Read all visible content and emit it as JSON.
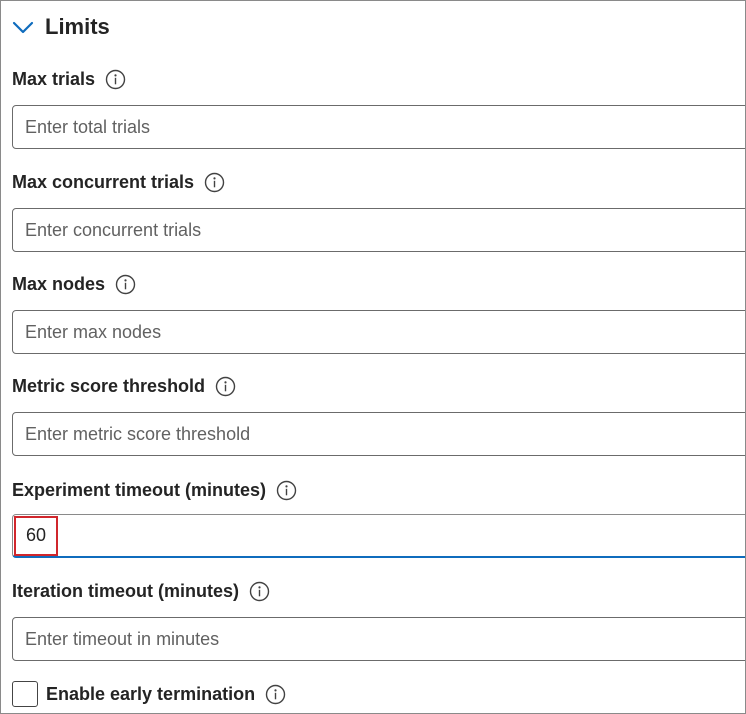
{
  "section": {
    "title": "Limits",
    "expanded": true
  },
  "fields": [
    {
      "label": "Max trials",
      "placeholder": "Enter total trials",
      "value": ""
    },
    {
      "label": "Max concurrent trials",
      "placeholder": "Enter concurrent trials",
      "value": ""
    },
    {
      "label": "Max nodes",
      "placeholder": "Enter max nodes",
      "value": ""
    },
    {
      "label": "Metric score threshold",
      "placeholder": "Enter metric score threshold",
      "value": ""
    },
    {
      "label": "Experiment timeout (minutes)",
      "placeholder": "",
      "value": "60"
    },
    {
      "label": "Iteration timeout (minutes)",
      "placeholder": "Enter timeout in minutes",
      "value": ""
    }
  ],
  "early_termination": {
    "label": "Enable early termination",
    "checked": false
  },
  "colors": {
    "accent": "#0f6cbd",
    "highlight": "#d0262c"
  }
}
